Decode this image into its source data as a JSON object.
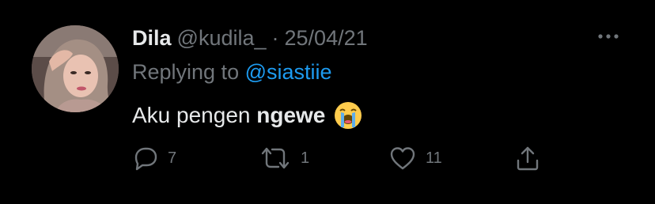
{
  "tweet": {
    "display_name": "Dila",
    "handle": "@kudila_",
    "separator": "·",
    "date": "25/04/21",
    "replying_prefix": "Replying to ",
    "replying_to": "@siastiie",
    "text_normal": "Aku pengen ",
    "text_bold": "ngewe",
    "emoji": "loudly-crying-face-emoji"
  },
  "actions": {
    "reply_count": "7",
    "retweet_count": "1",
    "like_count": "11"
  },
  "icons": {
    "more": "more-horizontal-icon",
    "reply": "reply-icon",
    "retweet": "retweet-icon",
    "like": "heart-icon",
    "share": "share-icon"
  },
  "colors": {
    "background": "#000000",
    "primary_text": "#e7e9ea",
    "secondary_text": "#71767b",
    "mention": "#1d9bf0"
  }
}
